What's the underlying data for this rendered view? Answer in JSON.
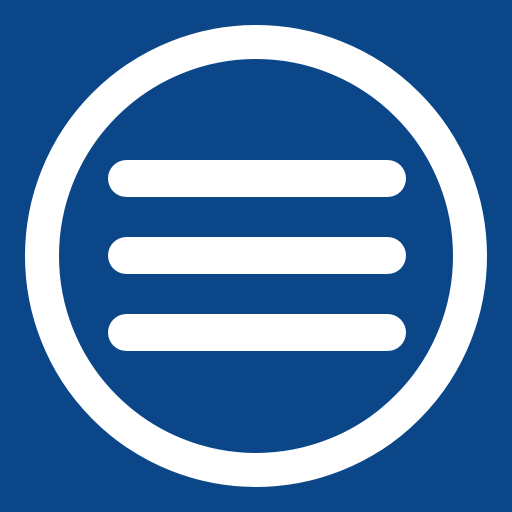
{
  "icon": {
    "name": "menu-icon",
    "background_color": "#0b4689",
    "foreground_color": "#ffffff"
  }
}
